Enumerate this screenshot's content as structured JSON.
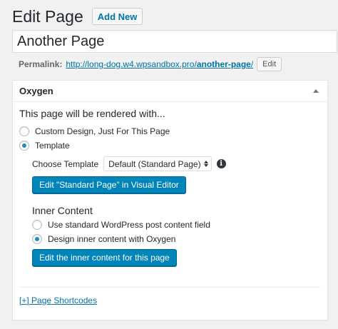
{
  "header": {
    "title": "Edit Page",
    "add_new_label": "Add New"
  },
  "title_field": {
    "value": "Another Page"
  },
  "permalink": {
    "label": "Permalink:",
    "url_base": "http://long-dog.w4.wpsandbox.pro/",
    "url_slug": "another-page",
    "url_trailing": "/",
    "edit_label": "Edit"
  },
  "metabox": {
    "title": "Oxygen",
    "toggle_icon": "caret-up-icon",
    "intro": "This page will be rendered with...",
    "render_options": [
      {
        "label": "Custom Design, Just For This Page",
        "checked": false
      },
      {
        "label": "Template",
        "checked": true
      }
    ],
    "choose_template_label": "Choose Template",
    "template_select_value": "Default (Standard Page)",
    "info_icon": "info-icon",
    "edit_template_button": "Edit \"Standard Page\" in Visual Editor",
    "inner_content_title": "Inner Content",
    "inner_options": [
      {
        "label": "Use standard WordPress post content field",
        "checked": false
      },
      {
        "label": "Design inner content with Oxygen",
        "checked": true
      }
    ],
    "edit_inner_button": "Edit the inner content for this page",
    "shortcodes_link": "[+] Page Shortcodes"
  },
  "colors": {
    "primary_button": "#0085ba",
    "link": "#0073aa",
    "background": "#f1f1f1"
  }
}
